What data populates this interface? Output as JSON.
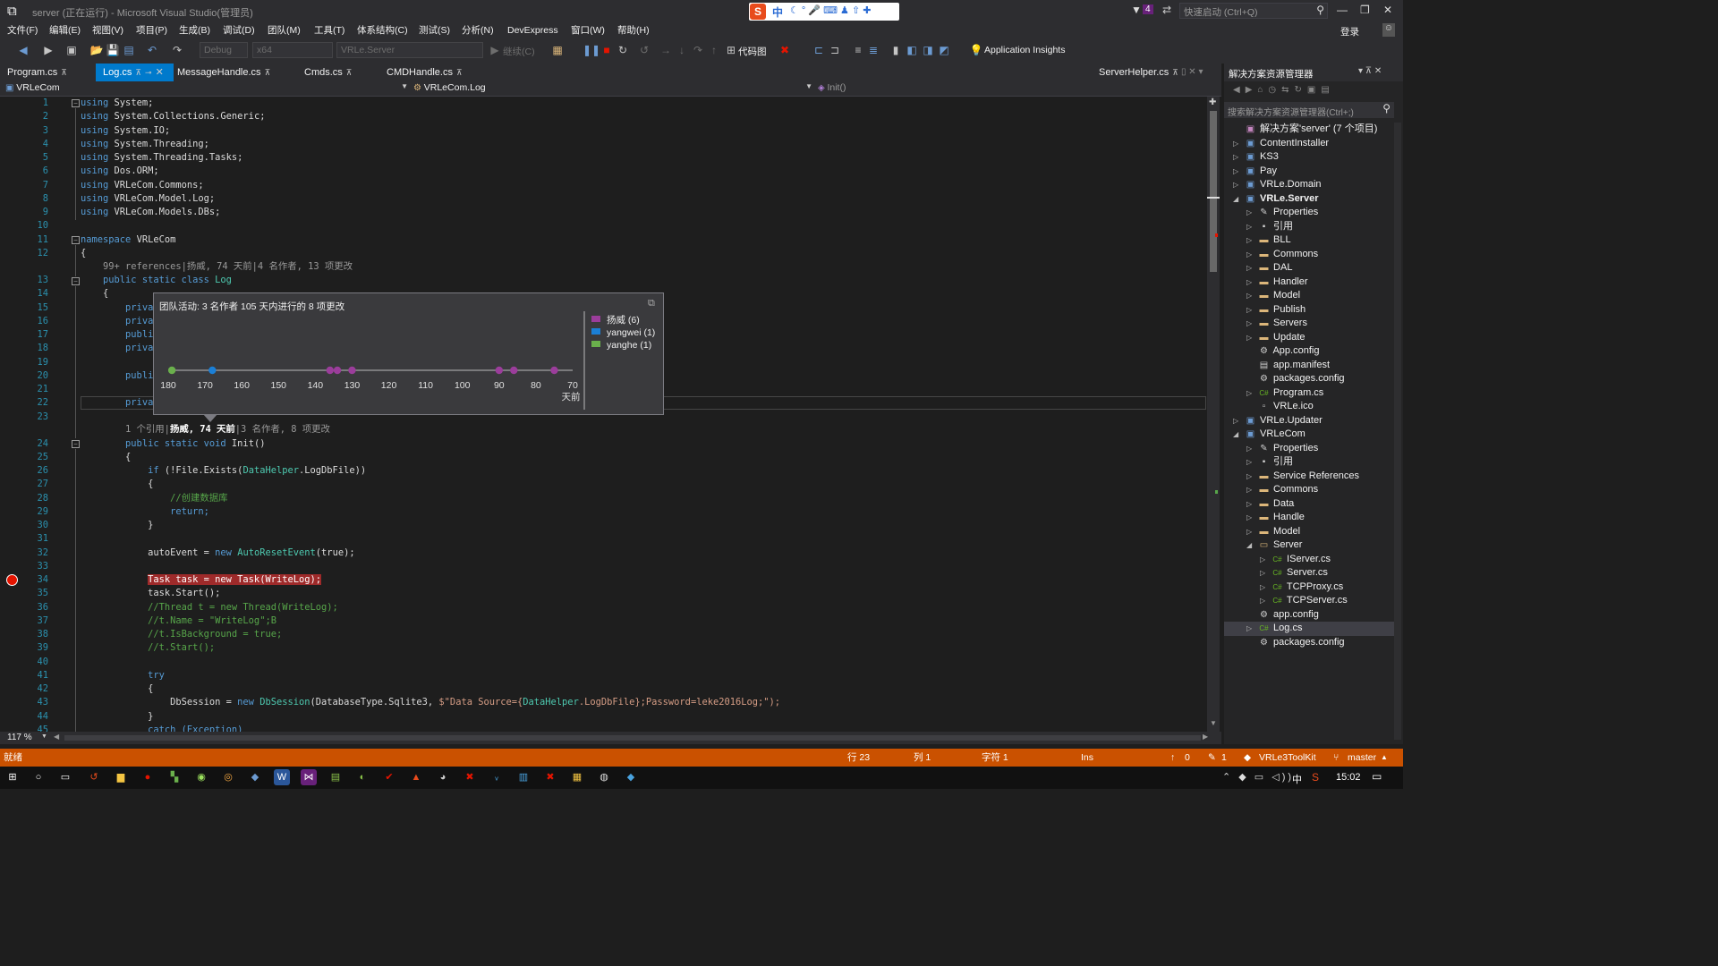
{
  "window": {
    "title": "server (正在运行) - Microsoft Visual Studio(管理员)",
    "notification_count": "4",
    "quick_launch_placeholder": "快速启动 (Ctrl+Q)",
    "login_label": "登录"
  },
  "menu": [
    "文件(F)",
    "编辑(E)",
    "视图(V)",
    "项目(P)",
    "生成(B)",
    "调试(D)",
    "团队(M)",
    "工具(T)",
    "体系结构(C)",
    "测试(S)",
    "分析(N)",
    "DevExpress",
    "窗口(W)",
    "帮助(H)"
  ],
  "toolbar": {
    "config": "Debug",
    "platform": "x64",
    "startup_project": "VRLe.Server",
    "continue_label": "继续(C)",
    "codemap_label": "代码图",
    "app_insights_label": "Application Insights"
  },
  "ime": {
    "lang": "中"
  },
  "tabs": [
    {
      "label": "Program.cs"
    },
    {
      "label": "Log.cs"
    },
    {
      "label": "MessageHandle.cs"
    },
    {
      "label": "Cmds.cs"
    },
    {
      "label": "CMDHandle.cs"
    },
    {
      "label": "ServerHelper.cs"
    }
  ],
  "navbar": {
    "project": "VRLeCom",
    "type": "VRLeCom.Log",
    "member": "Init()"
  },
  "code_lines": [
    {
      "n": "1"
    },
    {
      "n": "2"
    },
    {
      "n": "3"
    },
    {
      "n": "4"
    },
    {
      "n": "5"
    },
    {
      "n": "6"
    },
    {
      "n": "7"
    },
    {
      "n": "8"
    },
    {
      "n": "9"
    },
    {
      "n": "10"
    },
    {
      "n": "11"
    },
    {
      "n": "12"
    },
    {
      "n": "13"
    },
    {
      "n": "14"
    },
    {
      "n": "15"
    },
    {
      "n": "16"
    },
    {
      "n": "17"
    },
    {
      "n": "18"
    },
    {
      "n": "19"
    },
    {
      "n": "20"
    },
    {
      "n": "21"
    },
    {
      "n": "22"
    },
    {
      "n": "23"
    },
    {
      "n": "24"
    },
    {
      "n": "25"
    },
    {
      "n": "26"
    },
    {
      "n": "27"
    },
    {
      "n": "28"
    },
    {
      "n": "29"
    },
    {
      "n": "30"
    },
    {
      "n": "31"
    },
    {
      "n": "32"
    },
    {
      "n": "33"
    },
    {
      "n": "34"
    },
    {
      "n": "35"
    },
    {
      "n": "36"
    },
    {
      "n": "37"
    },
    {
      "n": "38"
    },
    {
      "n": "39"
    },
    {
      "n": "40"
    },
    {
      "n": "41"
    },
    {
      "n": "42"
    },
    {
      "n": "43"
    },
    {
      "n": "44"
    },
    {
      "n": "45"
    }
  ],
  "code": {
    "l1": "System;",
    "l2": "System.Collections.Generic;",
    "l3": "System.IO;",
    "l4": "System.Threading;",
    "l5": "System.Threading.Tasks;",
    "l6": "Dos.ORM;",
    "l7": "VRLeCom.Commons;",
    "l8": "VRLeCom.Model.Log;",
    "l9": "VRLeCom.Models.DBs;",
    "l11": "VRLeCom",
    "l13": "Log",
    "l15": "priva",
    "l16": "priva",
    "l17": "publi",
    "l18": "priva",
    "l20": "publi",
    "l22": "priva",
    "l24": "Init()",
    "l26a": "(!File.Exists(",
    "l26b": "DataHelper",
    "l26c": ".LogDbFile))",
    "l28": "//创建数据库",
    "l29": "return;",
    "l32a": "autoEvent = ",
    "l32b": "AutoResetEvent",
    "l32c": "(true);",
    "l34": "Task task = new Task(WriteLog);",
    "l35": "task.Start();",
    "l36": "//Thread t = new Thread(WriteLog);",
    "l37": "//t.Name = \"WriteLog\";B",
    "l38": "//t.IsBackground = true;",
    "l39": "//t.Start();",
    "l41": "try",
    "l43a": "DbSession = ",
    "l43b": "DbSession",
    "l43c": "(DatabaseType.Sqlite3, ",
    "l43d": "$\"Data Source={",
    "l43e": "DataHelper",
    "l43f": ".LogDbFile};Password=leke2016Log;\");",
    "l45": "catch (Exception)"
  },
  "codelens": {
    "class_lens": "99+ references|扬威, 74 天前|4 名作者, 13 项更改",
    "method_lens_pre": "1 个引用|",
    "method_lens_bold": "扬威, 74 天前",
    "method_lens_post": "|3 名作者, 8 项更改"
  },
  "popup": {
    "title": "团队活动: 3 名作者 105 天内进行的 8 项更改"
  },
  "chart_data": {
    "type": "scatter",
    "title": "团队活动: 3 名作者 105 天内进行的 8 项更改",
    "xlabel": "天前",
    "xlim": [
      180,
      70
    ],
    "xticks": [
      "180",
      "170",
      "160",
      "150",
      "140",
      "130",
      "120",
      "110",
      "100",
      "90",
      "80",
      "70"
    ],
    "series": [
      {
        "name": "扬威 (6)",
        "color": "#9b3d9b",
        "x": [
          136,
          134,
          130,
          90,
          86,
          75
        ]
      },
      {
        "name": "yangwei (1)",
        "color": "#1b7fd6",
        "x": [
          168
        ]
      },
      {
        "name": "yanghe (1)",
        "color": "#6ab04c",
        "x": [
          179
        ]
      }
    ],
    "legend": "right"
  },
  "explorer": {
    "title": "解决方案资源管理器",
    "search_placeholder": "搜索解决方案资源管理器(Ctrl+;)",
    "items": [
      {
        "label": "解决方案'server' (7 个项目)",
        "icon": "solution-icon"
      },
      {
        "label": "ContentInstaller",
        "icon": "csproj-icon"
      },
      {
        "label": "KS3",
        "icon": "csproj-icon"
      },
      {
        "label": "Pay",
        "icon": "csproj-icon"
      },
      {
        "label": "VRLe.Domain",
        "icon": "csproj-icon"
      },
      {
        "label": "VRLe.Server",
        "icon": "csproj-icon"
      },
      {
        "label": "Properties",
        "icon": "wrench-icon"
      },
      {
        "label": "引用",
        "icon": "references-icon"
      },
      {
        "label": "BLL",
        "icon": "folder-icon"
      },
      {
        "label": "Commons",
        "icon": "folder-icon"
      },
      {
        "label": "DAL",
        "icon": "folder-icon"
      },
      {
        "label": "Handler",
        "icon": "folder-icon"
      },
      {
        "label": "Model",
        "icon": "folder-icon"
      },
      {
        "label": "Publish",
        "icon": "folder-icon"
      },
      {
        "label": "Servers",
        "icon": "folder-icon"
      },
      {
        "label": "Update",
        "icon": "folder-icon"
      },
      {
        "label": "App.config",
        "icon": "config-icon"
      },
      {
        "label": "app.manifest",
        "icon": "manifest-icon"
      },
      {
        "label": "packages.config",
        "icon": "config-icon"
      },
      {
        "label": "Program.cs",
        "icon": "csharp-icon"
      },
      {
        "label": "VRLe.ico",
        "icon": "ico-icon"
      },
      {
        "label": "VRLe.Updater",
        "icon": "csproj-icon"
      },
      {
        "label": "VRLeCom",
        "icon": "csproj-icon"
      },
      {
        "label": "Properties",
        "icon": "wrench-icon"
      },
      {
        "label": "引用",
        "icon": "references-icon"
      },
      {
        "label": "Service References",
        "icon": "folder-icon"
      },
      {
        "label": "Commons",
        "icon": "folder-icon"
      },
      {
        "label": "Data",
        "icon": "folder-icon"
      },
      {
        "label": "Handle",
        "icon": "folder-icon"
      },
      {
        "label": "Model",
        "icon": "folder-icon"
      },
      {
        "label": "Server",
        "icon": "folder-open-icon"
      },
      {
        "label": "IServer.cs",
        "icon": "csharp-icon"
      },
      {
        "label": "Server.cs",
        "icon": "csharp-icon"
      },
      {
        "label": "TCPProxy.cs",
        "icon": "csharp-icon"
      },
      {
        "label": "TCPServer.cs",
        "icon": "csharp-icon"
      },
      {
        "label": "app.config",
        "icon": "config-icon"
      },
      {
        "label": "Log.cs",
        "icon": "csharp-icon"
      },
      {
        "label": "packages.config",
        "icon": "config-icon"
      }
    ]
  },
  "zoom": "117 %",
  "status": {
    "ready": "就绪",
    "line": "行 23",
    "col": "列 1",
    "char": "字符 1",
    "ins": "Ins",
    "up_count": "0",
    "edit_count": "1",
    "toolkit": "VRLe3ToolKit",
    "branch": "master"
  },
  "taskbar": {
    "time": "15:02",
    "ime": "中"
  },
  "colors": {
    "accent": "#007acc",
    "status_debug": "#ca5100",
    "editor_bg": "#1e1e1e",
    "chrome_bg": "#2d2d30"
  }
}
